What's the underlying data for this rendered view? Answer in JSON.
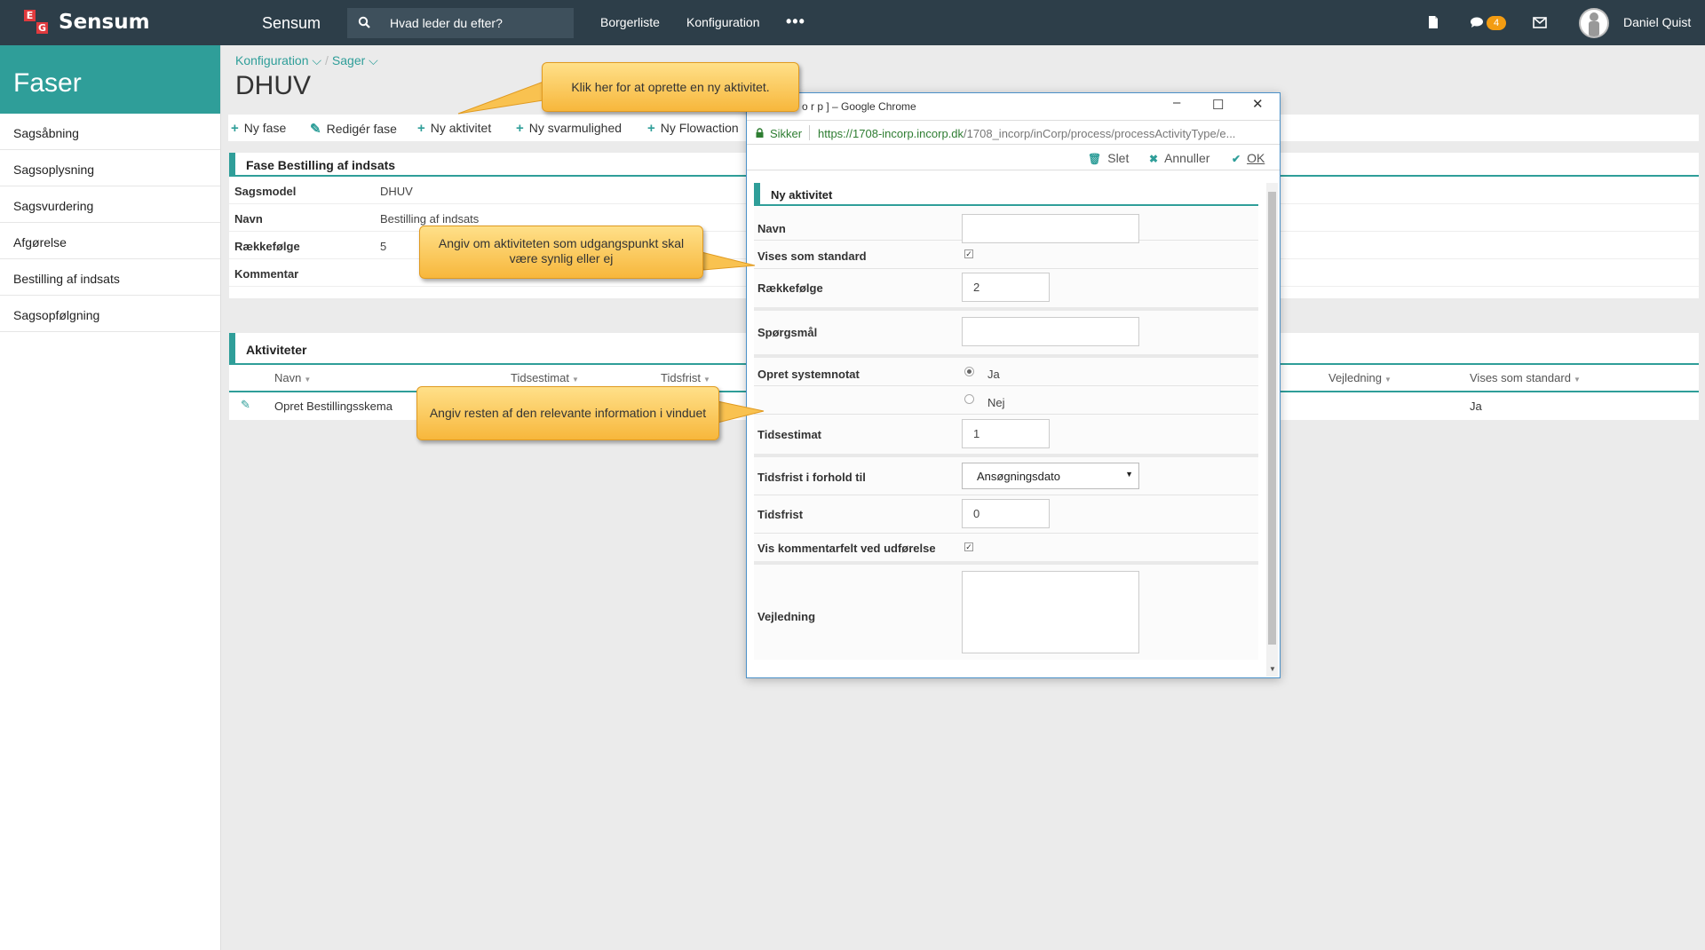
{
  "topbar": {
    "brand_letters": [
      "E",
      "G"
    ],
    "brand": "Sensum",
    "app_title": "Sensum",
    "search_placeholder": "Hvad leder du efter?",
    "nav": [
      "Borgerliste",
      "Konfiguration"
    ],
    "more": "•••",
    "chat_count": "4",
    "user_name": "Daniel Quist",
    "colors": {
      "bar": "#2d3e49",
      "badge": "#f39c12",
      "logo_red": "#e03a3e"
    }
  },
  "sidebar": {
    "title": "Faser",
    "items": [
      "Sagsåbning",
      "Sagsoplysning",
      "Sagsvurdering",
      "Afgørelse",
      "Bestilling af indsats",
      "Sagsopfølgning"
    ],
    "accent": "#2f9e99"
  },
  "main": {
    "breadcrumb": [
      "Konfiguration",
      "Sager"
    ],
    "title": "DHUV",
    "toolbar": [
      "Ny fase",
      "Redigér fase",
      "Ny aktivitet",
      "Ny svarmulighed",
      "Ny Flowaction"
    ],
    "phase_panel": {
      "title": "Fase Bestilling af indsats",
      "rows": [
        {
          "label": "Sagsmodel",
          "value": "DHUV"
        },
        {
          "label": "Navn",
          "value": "Bestilling af indsats"
        },
        {
          "label": "Rækkefølge",
          "value": "5"
        },
        {
          "label": "Kommentar",
          "value": ""
        }
      ]
    },
    "activities": {
      "title": "Aktiviteter",
      "columns": [
        "Navn",
        "Tidsestimat",
        "Tidsfrist",
        "Vejledning",
        "Vises som standard"
      ],
      "rows": [
        {
          "name": "Opret Bestillingsskema",
          "visible_default": "Ja"
        }
      ]
    }
  },
  "modal": {
    "window_title": "o r p ] – Google Chrome",
    "secure_label": "Sikker",
    "url_host": "https://1708-incorp.incorp.dk",
    "url_path": "/1708_incorp/inCorp/process/processActivityType/e...",
    "actions": [
      "Slet",
      "Annuller",
      "OK"
    ],
    "form_title": "Ny aktivitet",
    "fields": {
      "navn": {
        "label": "Navn",
        "value": ""
      },
      "vises": {
        "label": "Vises som standard",
        "checked": true
      },
      "raekkefolge": {
        "label": "Rækkefølge",
        "value": "2"
      },
      "sporgsmaal": {
        "label": "Spørgsmål",
        "value": ""
      },
      "systemnotat": {
        "label": "Opret systemnotat",
        "options": [
          "Ja",
          "Nej"
        ],
        "selected": "Ja"
      },
      "tidsestimat": {
        "label": "Tidsestimat",
        "value": "1"
      },
      "tidsfrist_ift": {
        "label": "Tidsfrist i forhold til",
        "selected": "Ansøgningsdato"
      },
      "tidsfrist": {
        "label": "Tidsfrist",
        "value": "0"
      },
      "kommentarfelt": {
        "label": "Vis kommentarfelt ved udførelse",
        "checked": true
      },
      "vejledning": {
        "label": "Vejledning",
        "value": ""
      }
    }
  },
  "callouts": {
    "new_activity": "Klik her for at oprette en ny aktivitet.",
    "visible": "Angiv om aktiviteten som udgangspunkt skal være synlig eller ej",
    "rest": "Angiv resten af den relevante information i vinduet"
  }
}
